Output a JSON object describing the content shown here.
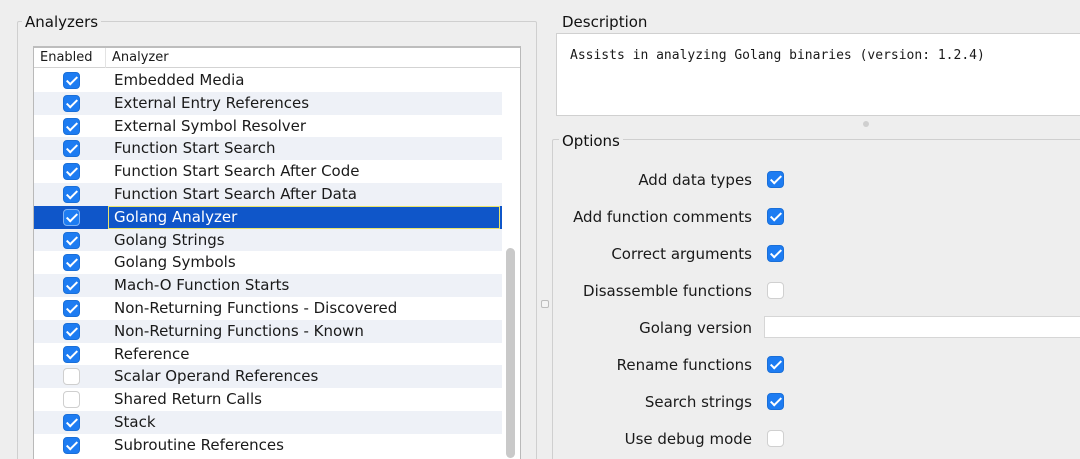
{
  "analyzers": {
    "title": "Analyzers",
    "columns": {
      "enabled": "Enabled",
      "analyzer": "Analyzer"
    },
    "rows": [
      {
        "label": "Embedded Media",
        "enabled": true
      },
      {
        "label": "External Entry References",
        "enabled": true
      },
      {
        "label": "External Symbol Resolver",
        "enabled": true
      },
      {
        "label": "Function Start Search",
        "enabled": true
      },
      {
        "label": "Function Start Search After Code",
        "enabled": true
      },
      {
        "label": "Function Start Search After Data",
        "enabled": true
      },
      {
        "label": "Golang Analyzer",
        "enabled": true,
        "selected": true
      },
      {
        "label": "Golang Strings",
        "enabled": true
      },
      {
        "label": "Golang Symbols",
        "enabled": true
      },
      {
        "label": "Mach-O Function Starts",
        "enabled": true
      },
      {
        "label": "Non-Returning Functions - Discovered",
        "enabled": true
      },
      {
        "label": "Non-Returning Functions - Known",
        "enabled": true
      },
      {
        "label": "Reference",
        "enabled": true
      },
      {
        "label": "Scalar Operand References",
        "enabled": false
      },
      {
        "label": "Shared Return Calls",
        "enabled": false
      },
      {
        "label": "Stack",
        "enabled": true
      },
      {
        "label": "Subroutine References",
        "enabled": true
      }
    ]
  },
  "description": {
    "title": "Description",
    "text": "Assists in analyzing Golang binaries (version: 1.2.4)"
  },
  "options": {
    "title": "Options",
    "items": [
      {
        "label": "Add data types",
        "type": "checkbox",
        "checked": true
      },
      {
        "label": "Add function comments",
        "type": "checkbox",
        "checked": true
      },
      {
        "label": "Correct arguments",
        "type": "checkbox",
        "checked": true
      },
      {
        "label": "Disassemble functions",
        "type": "checkbox",
        "checked": false
      },
      {
        "label": "Golang version",
        "type": "text",
        "value": ""
      },
      {
        "label": "Rename functions",
        "type": "checkbox",
        "checked": true
      },
      {
        "label": "Search strings",
        "type": "checkbox",
        "checked": true
      },
      {
        "label": "Use debug mode",
        "type": "checkbox",
        "checked": false
      }
    ]
  },
  "colors": {
    "selection": "#0f56c9",
    "checkbox_on": "#1d7cf2",
    "background": "#eeeeee"
  }
}
